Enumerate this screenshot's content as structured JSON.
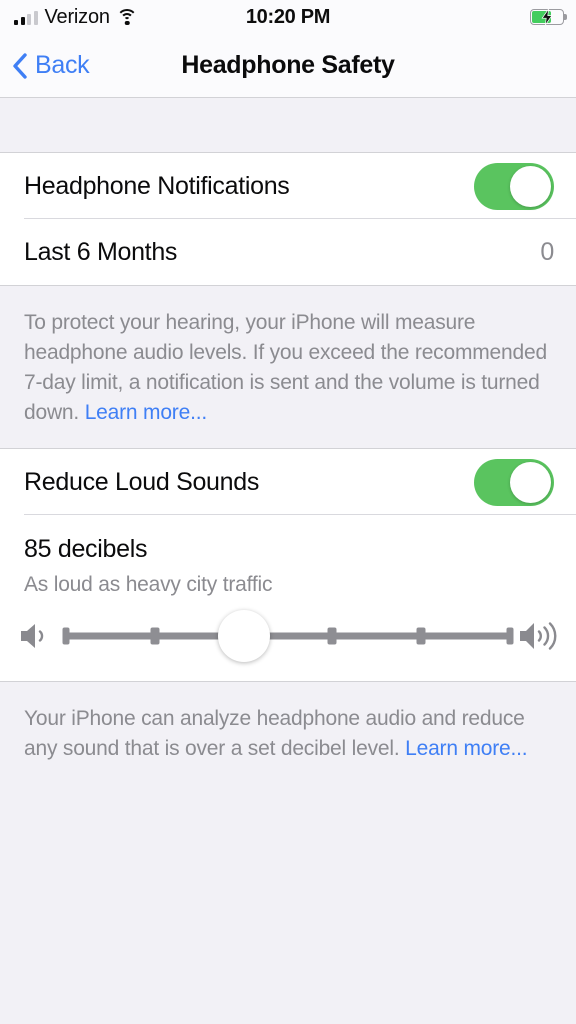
{
  "status_bar": {
    "carrier": "Verizon",
    "time": "10:20 PM",
    "signal_bars_filled": 2,
    "signal_bars_total": 4,
    "wifi_icon": "wifi-icon",
    "battery_icon": "battery-charging-icon",
    "battery_level_percent": 65,
    "battery_color": "#43cd5e"
  },
  "nav": {
    "back_label": "Back",
    "back_icon": "chevron-left-icon",
    "title": "Headphone Safety",
    "tint_color": "#3f7ff5"
  },
  "section_one": {
    "rows": [
      {
        "label": "Headphone Notifications",
        "control": "toggle",
        "toggle_on": true
      },
      {
        "label": "Last 6 Months",
        "value": "0"
      }
    ],
    "footer": {
      "text_before_link": "To protect your hearing, your iPhone will measure headphone audio levels. If you exceed the recommended 7-day limit, a notification is sent and the volume is turned down. ",
      "link_text": "Learn more..."
    }
  },
  "section_two": {
    "rows": [
      {
        "label": "Reduce Loud Sounds",
        "control": "toggle",
        "toggle_on": true
      }
    ],
    "decibel": {
      "title": "85 decibels",
      "subtitle": "As loud as heavy city traffic"
    },
    "slider": {
      "min_icon": "speaker-low-icon",
      "max_icon": "speaker-high-icon",
      "value": 85,
      "tick_count": 4,
      "thumb_position_percent": 40
    },
    "footer": {
      "text_before_link": "Your iPhone can analyze headphone audio and reduce any sound that is over a set decibel level. ",
      "link_text": "Learn more..."
    }
  },
  "colors": {
    "toggle_on": "#5ac45f",
    "link": "#3f7ff5",
    "background": "#f2f1f6",
    "cell_background": "#ffffff",
    "secondary_text": "#8b8b90"
  }
}
